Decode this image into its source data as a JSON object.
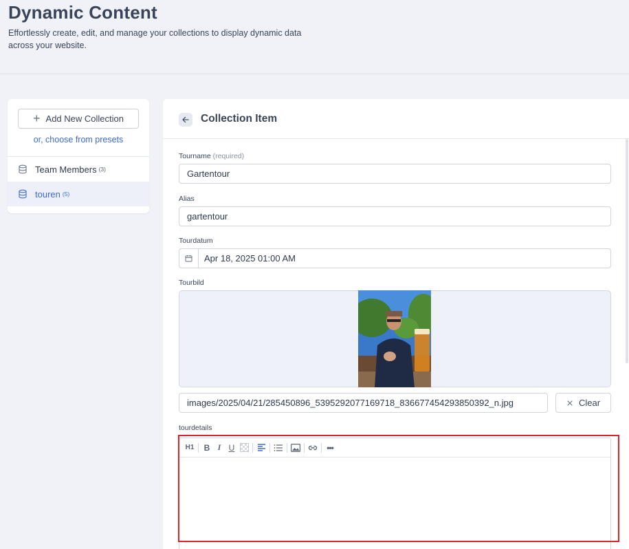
{
  "header": {
    "title": "Dynamic Content",
    "subtitle": "Effortlessly create, edit, and manage your collections to display dynamic data across your website."
  },
  "sidebar": {
    "add_button_label": "Add New Collection",
    "presets_link": "or, choose from presets",
    "collections": [
      {
        "label": "Team Members",
        "count": "(3)",
        "icon": "database-icon",
        "active": false
      },
      {
        "label": "touren",
        "count": "(5)",
        "icon": "database-icon",
        "active": true
      }
    ]
  },
  "main": {
    "title": "Collection Item",
    "fields": {
      "tourname": {
        "label": "Tourname",
        "hint": "(required)",
        "value": "Gartentour"
      },
      "alias": {
        "label": "Alias",
        "value": "gartentour"
      },
      "tourdatum": {
        "label": "Tourdatum",
        "value": "Apr 18, 2025 01:00 AM",
        "icon": "calendar-icon"
      },
      "tourbild": {
        "label": "Tourbild",
        "path": "images/2025/04/21/285450896_5395292077169718_836677454293850392_n.jpg",
        "clear_label": "Clear"
      },
      "tourdetails": {
        "label": "tourdetails",
        "content": ""
      }
    },
    "editor_toolbar": {
      "heading": "H1",
      "bold": "B",
      "italic": "I",
      "underline": "U",
      "more": "•••"
    }
  },
  "colors": {
    "accent": "#3b6ad6",
    "background": "#f0f2f8",
    "highlight_border": "#d9242b"
  }
}
